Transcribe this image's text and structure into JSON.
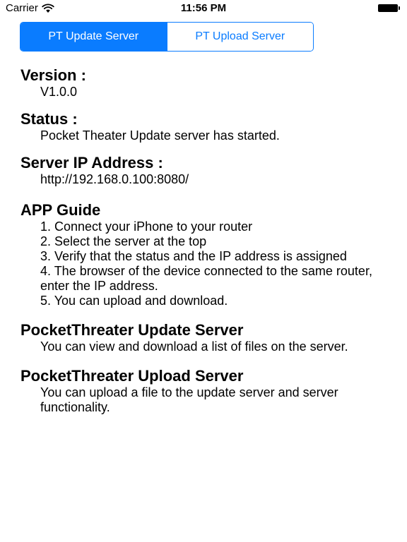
{
  "status_bar": {
    "carrier": "Carrier",
    "time": "11:56 PM"
  },
  "segmented": {
    "items": [
      {
        "label": "PT Update Server",
        "selected": true
      },
      {
        "label": "PT Upload Server",
        "selected": false
      }
    ],
    "accent_color": "#0a7cff"
  },
  "sections": {
    "version": {
      "heading": "Version :",
      "value": "V1.0.0"
    },
    "status": {
      "heading": "Status :",
      "value": "Pocket Theater Update server has started."
    },
    "ip": {
      "heading": "Server IP Address :",
      "value": "http://192.168.0.100:8080/"
    },
    "guide": {
      "heading": "APP Guide",
      "lines": [
        "1. Connect your iPhone to your router",
        "2. Select the server at the top",
        "3. Verify that the status and the IP address is assigned",
        "4. The browser of the device connected to the same router, enter the IP address.",
        "5. You can upload and download."
      ]
    },
    "update_server": {
      "heading": "PocketThreater Update Server",
      "text": "You can view and download a list of files on the server."
    },
    "upload_server": {
      "heading": "PocketThreater Upload Server",
      "text": "You can upload a file to the update server and server functionality."
    }
  }
}
